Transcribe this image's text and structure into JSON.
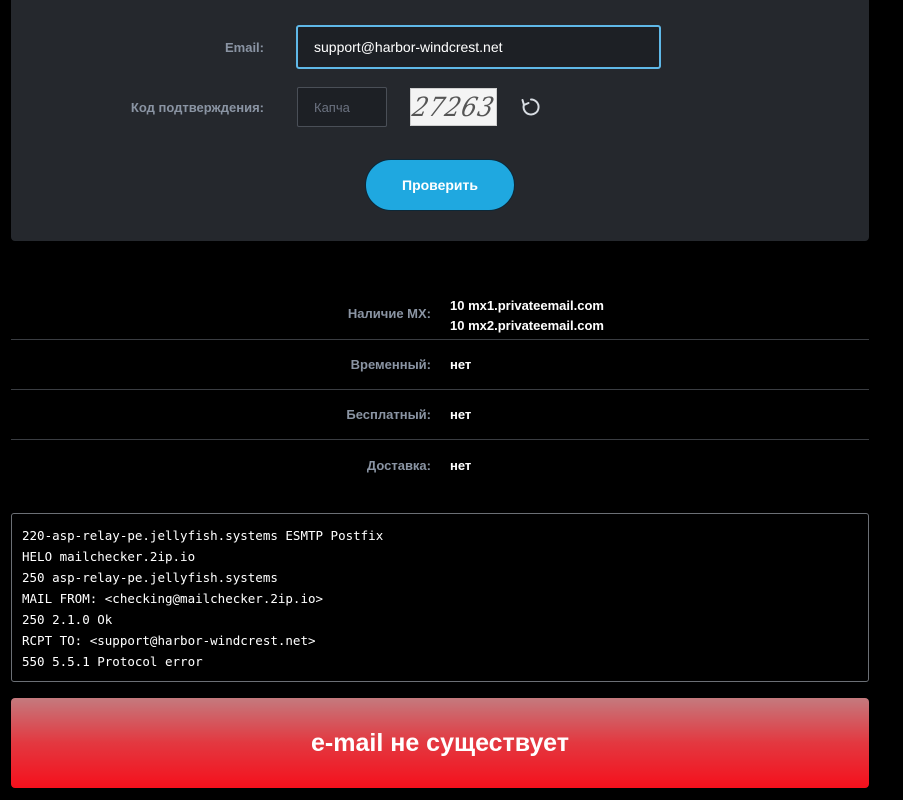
{
  "form": {
    "email_label": "Email:",
    "email_value": "support@harbor-windcrest.net",
    "captcha_label": "Код подтверждения:",
    "captcha_placeholder": "Капча",
    "captcha_image_text": "27263",
    "check_button": "Проверить"
  },
  "results": {
    "mx_label": "Наличие MX:",
    "mx_records": [
      {
        "priority": "10",
        "host": "mx1.privateemail.com"
      },
      {
        "priority": "10",
        "host": "mx2.privateemail.com"
      }
    ],
    "temporary_label": "Временный:",
    "temporary_value": "нет",
    "free_label": "Бесплатный:",
    "free_value": "нет",
    "delivery_label": "Доставка:",
    "delivery_value": "нет"
  },
  "smtp_log": [
    "220-asp-relay-pe.jellyfish.systems ESMTP Postfix",
    "HELO mailchecker.2ip.io",
    "250 asp-relay-pe.jellyfish.systems",
    "MAIL FROM: <checking@mailchecker.2ip.io>",
    "250 2.1.0 Ok",
    "RCPT TO: <support@harbor-windcrest.net>",
    "550 5.5.1 Protocol error"
  ],
  "verdict": {
    "text": "e-mail не существует"
  },
  "colors": {
    "panel": "#25282d",
    "accent": "#1fa8e0",
    "label": "#8a94a3",
    "error": "#f5101c"
  }
}
